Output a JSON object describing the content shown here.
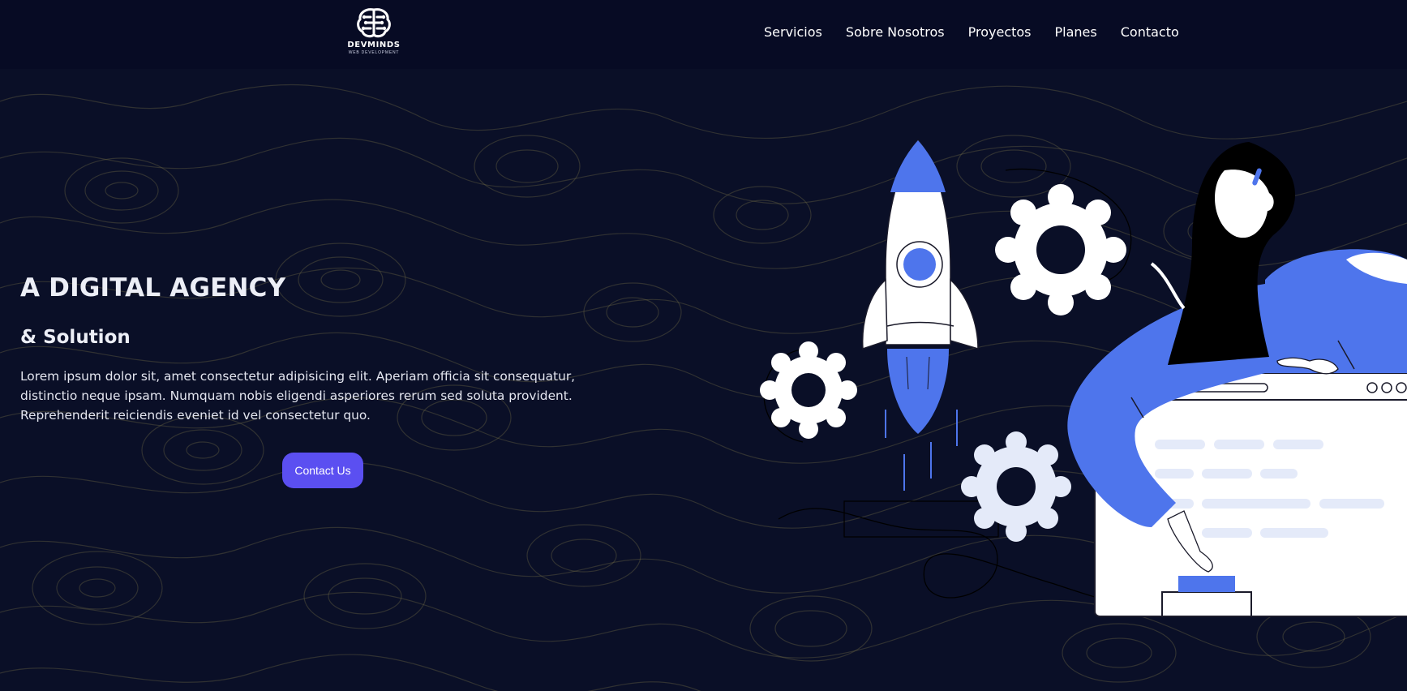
{
  "header": {
    "logo_name": "DEVMINDS",
    "logo_tagline": "WEB DEVELOPMENT",
    "nav": [
      {
        "label": "Servicios"
      },
      {
        "label": "Sobre Nosotros"
      },
      {
        "label": "Proyectos"
      },
      {
        "label": "Planes"
      },
      {
        "label": "Contacto"
      }
    ]
  },
  "hero": {
    "title": "A DIGITAL AGENCY",
    "subtitle": "& Solution",
    "description": "Lorem ipsum dolor sit, amet consectetur adipisicing elit. Aperiam officia sit consequatur, distinctio neque ipsam. Numquam nobis eligendi asperiores rerum sed soluta provident. Reprehenderit reiciendis eveniet id vel consectetur quo.",
    "cta_label": "Contact Us"
  },
  "illustration": {
    "icons": [
      "rocket-icon",
      "gear-icon",
      "browser-window-icon",
      "person-icon"
    ]
  },
  "colors": {
    "background": "#070b24",
    "accent": "#5b4ff1",
    "illustration_blue": "#4e75ec",
    "topo_lines": "#6e6a45"
  }
}
